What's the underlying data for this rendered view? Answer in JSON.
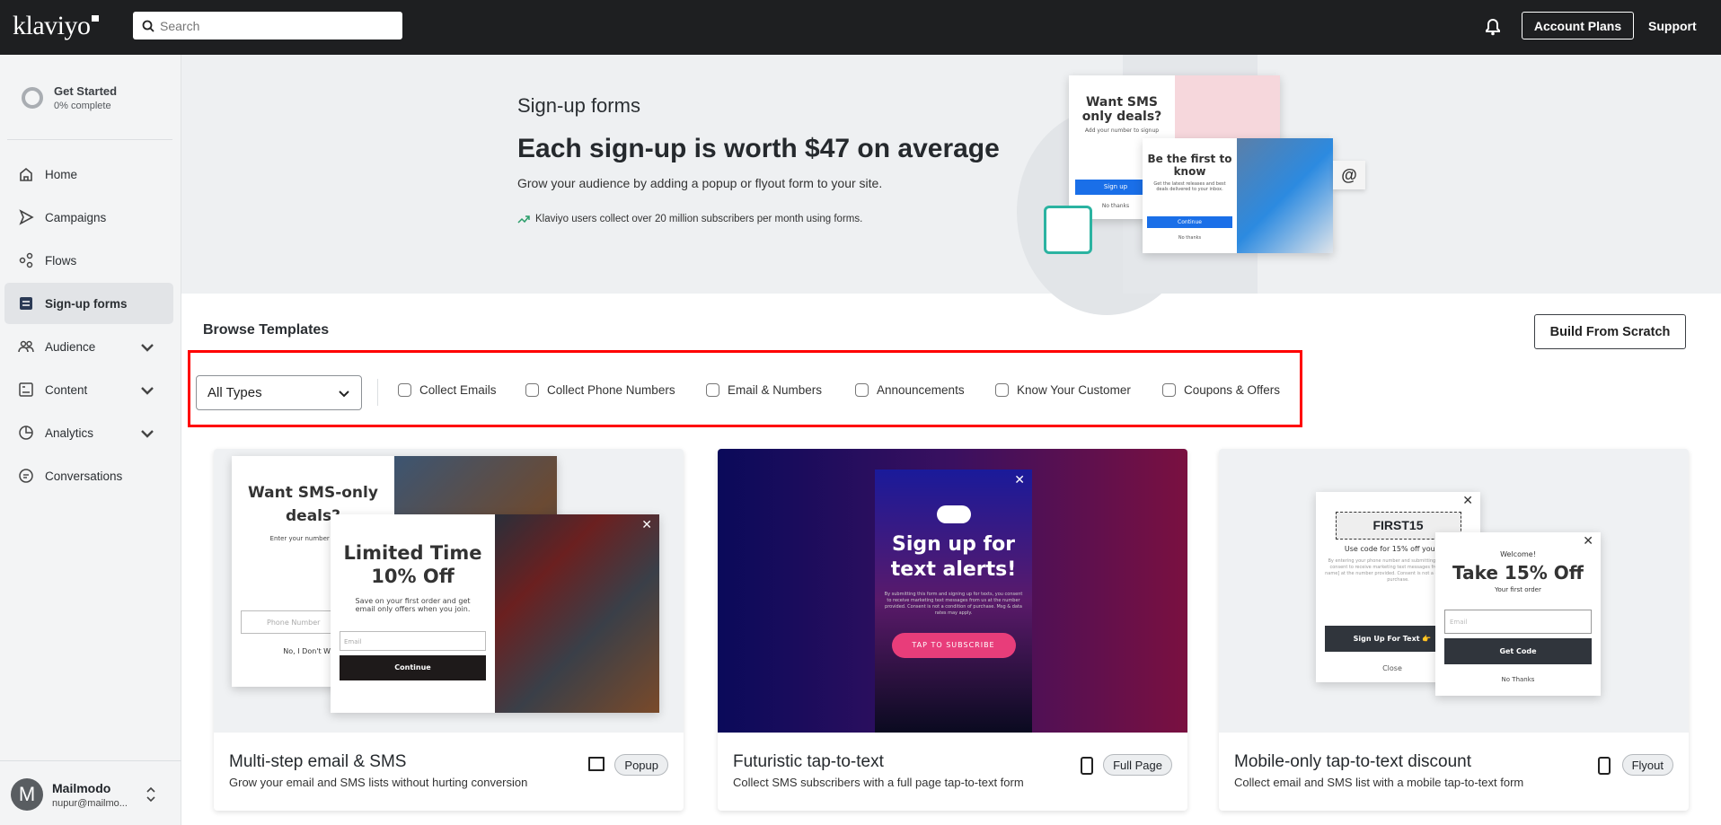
{
  "topbar": {
    "logo": "klaviyo",
    "search_placeholder": "Search",
    "account_plans": "Account Plans",
    "support": "Support"
  },
  "sidebar": {
    "get_started": "Get Started",
    "progress_text": "0% complete",
    "progress": 0,
    "items": [
      {
        "label": "Home",
        "icon": "home-icon"
      },
      {
        "label": "Campaigns",
        "icon": "send-icon"
      },
      {
        "label": "Flows",
        "icon": "flows-icon"
      },
      {
        "label": "Sign-up forms",
        "icon": "form-icon",
        "active": true
      },
      {
        "label": "Audience",
        "icon": "users-icon",
        "expandable": true
      },
      {
        "label": "Content",
        "icon": "content-icon",
        "expandable": true
      },
      {
        "label": "Analytics",
        "icon": "pie-chart-icon",
        "expandable": true
      },
      {
        "label": "Conversations",
        "icon": "chat-icon"
      }
    ],
    "user": {
      "initial": "M",
      "name": "Mailmodo",
      "email": "nupur@mailmo..."
    }
  },
  "hero": {
    "subtitle": "Sign-up forms",
    "title": "Each sign-up is worth $47 on average",
    "description": "Grow your audience by adding a popup or flyout form to your site.",
    "stat": "Klaviyo users collect over 20 million subscribers per month using forms.",
    "illustration": {
      "popup1_title": "Want SMS only deals?",
      "popup1_sub": "Add your number to signup",
      "popup1_button": "Sign up",
      "popup1_link": "No thanks",
      "popup2_title": "Be the first to know",
      "popup2_sub": "Get the latest releases and best deals delivered to your inbox.",
      "popup2_button": "Continue",
      "popup2_link": "No thanks"
    }
  },
  "browse": {
    "title": "Browse Templates",
    "build_button": "Build From Scratch",
    "type_select": "All Types",
    "filters": [
      "Collect Emails",
      "Collect Phone Numbers",
      "Email & Numbers",
      "Announcements",
      "Know Your Customer",
      "Coupons & Offers"
    ]
  },
  "highlight_color": "#ff0000",
  "cards": [
    {
      "title": "Multi-step email & SMS",
      "description": "Grow your email and SMS lists without hurting conversion",
      "type": "Popup",
      "device": "desktop-mobile-icon",
      "preview": {
        "back_title": "Want SMS-only deals?",
        "back_sub": "Enter your number to get S",
        "back_phone": "Phone Number",
        "back_link": "No, I Don't Want",
        "front_title": "Limited Time 10% Off",
        "front_sub": "Save on your first order and get email only offers when you join.",
        "front_email": "Email",
        "front_button": "Continue"
      }
    },
    {
      "title": "Futuristic tap-to-text",
      "description": "Collect SMS subscribers with a full page tap-to-text form",
      "type": "Full Page",
      "device": "mobile-icon",
      "preview": {
        "title": "Sign up for text alerts!",
        "button": "TAP TO SUBSCRIBE"
      }
    },
    {
      "title": "Mobile-only tap-to-text discount",
      "description": "Collect email and SMS list with a mobile tap-to-text form",
      "type": "Flyout",
      "device": "mobile-icon",
      "preview": {
        "code": "FIRST15",
        "code_sub": "Use code for 15% off your firs",
        "back_button": "Sign Up For Text 👉",
        "back_link": "Close",
        "welcome": "Welcome!",
        "front_title": "Take 15% Off",
        "front_sub": "Your first order",
        "front_email": "Email",
        "front_button": "Get Code",
        "front_link": "No Thanks"
      }
    }
  ]
}
